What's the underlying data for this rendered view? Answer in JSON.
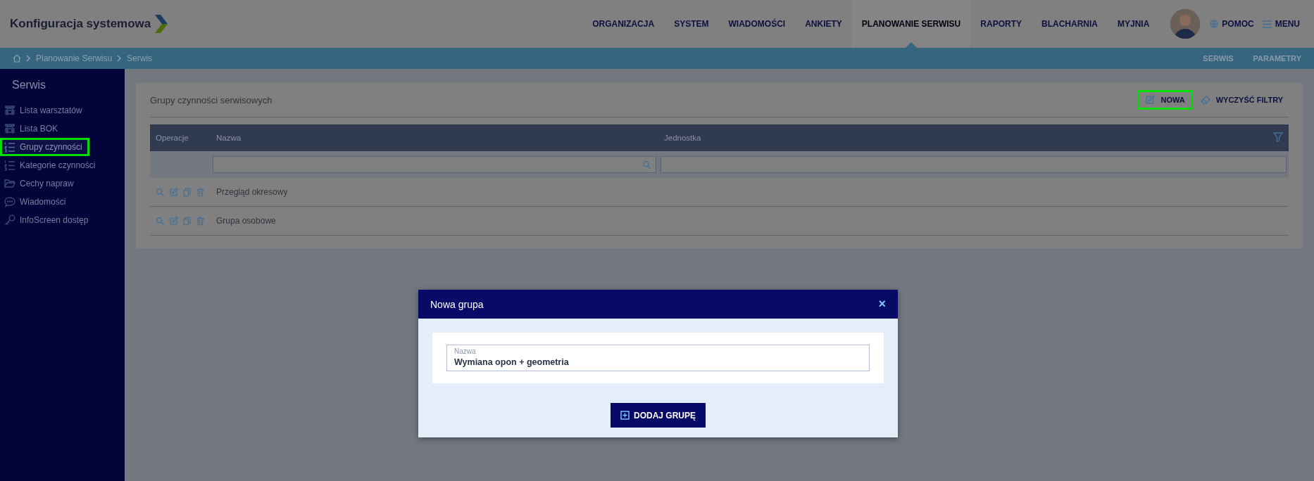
{
  "header": {
    "title": "Konfiguracja systemowa",
    "nav": [
      {
        "label": "ORGANIZACJA",
        "selected": false
      },
      {
        "label": "SYSTEM",
        "selected": false
      },
      {
        "label": "WIADOMOŚCI",
        "selected": false
      },
      {
        "label": "ANKIETY",
        "selected": false
      },
      {
        "label": "PLANOWANIE SERWISU",
        "selected": true
      },
      {
        "label": "RAPORTY",
        "selected": false
      },
      {
        "label": "BLACHARNIA",
        "selected": false
      },
      {
        "label": "MYJNIA",
        "selected": false
      }
    ],
    "help": "POMOC",
    "menu": "MENU"
  },
  "breadcrumb": [
    "Planowanie Serwisu",
    "Serwis"
  ],
  "subnav": [
    "SERWIS",
    "PARAMETRY"
  ],
  "sidebar": {
    "title": "Serwis",
    "items": [
      {
        "label": "Lista warsztatów",
        "kind": "car",
        "selected": false,
        "highlighted": false
      },
      {
        "label": "Lista BOK",
        "kind": "car",
        "selected": false,
        "highlighted": false
      },
      {
        "label": "Grupy czynności",
        "kind": "list",
        "selected": true,
        "highlighted": true
      },
      {
        "label": "Kategorie czynności",
        "kind": "list",
        "selected": false,
        "highlighted": false
      },
      {
        "label": "Cechy napraw",
        "kind": "folder",
        "selected": false,
        "highlighted": false
      },
      {
        "label": "Wiadomości",
        "kind": "chat",
        "selected": false,
        "highlighted": false
      },
      {
        "label": "InfoScreen dostęp",
        "kind": "key",
        "selected": false,
        "highlighted": false
      }
    ]
  },
  "panel": {
    "title": "Grupy czynności serwisowych",
    "actions": [
      {
        "label": "NOWA",
        "kind": "edit",
        "highlighted": true
      },
      {
        "label": "WYCZYŚĆ FILTRY",
        "kind": "eraser",
        "highlighted": false
      }
    ],
    "table": {
      "columns": [
        "Operacje",
        "Nazwa",
        "Jednostka"
      ],
      "rows": [
        {
          "name": "Przegląd okresowy"
        },
        {
          "name": "Grupa osobowe"
        }
      ]
    }
  },
  "dialog": {
    "title": "Nowa grupa",
    "close": "×",
    "field": {
      "label": "Nazwa",
      "value": "Wymiana opon + geometria"
    },
    "submit": "DODAJ GRUPĘ"
  }
}
